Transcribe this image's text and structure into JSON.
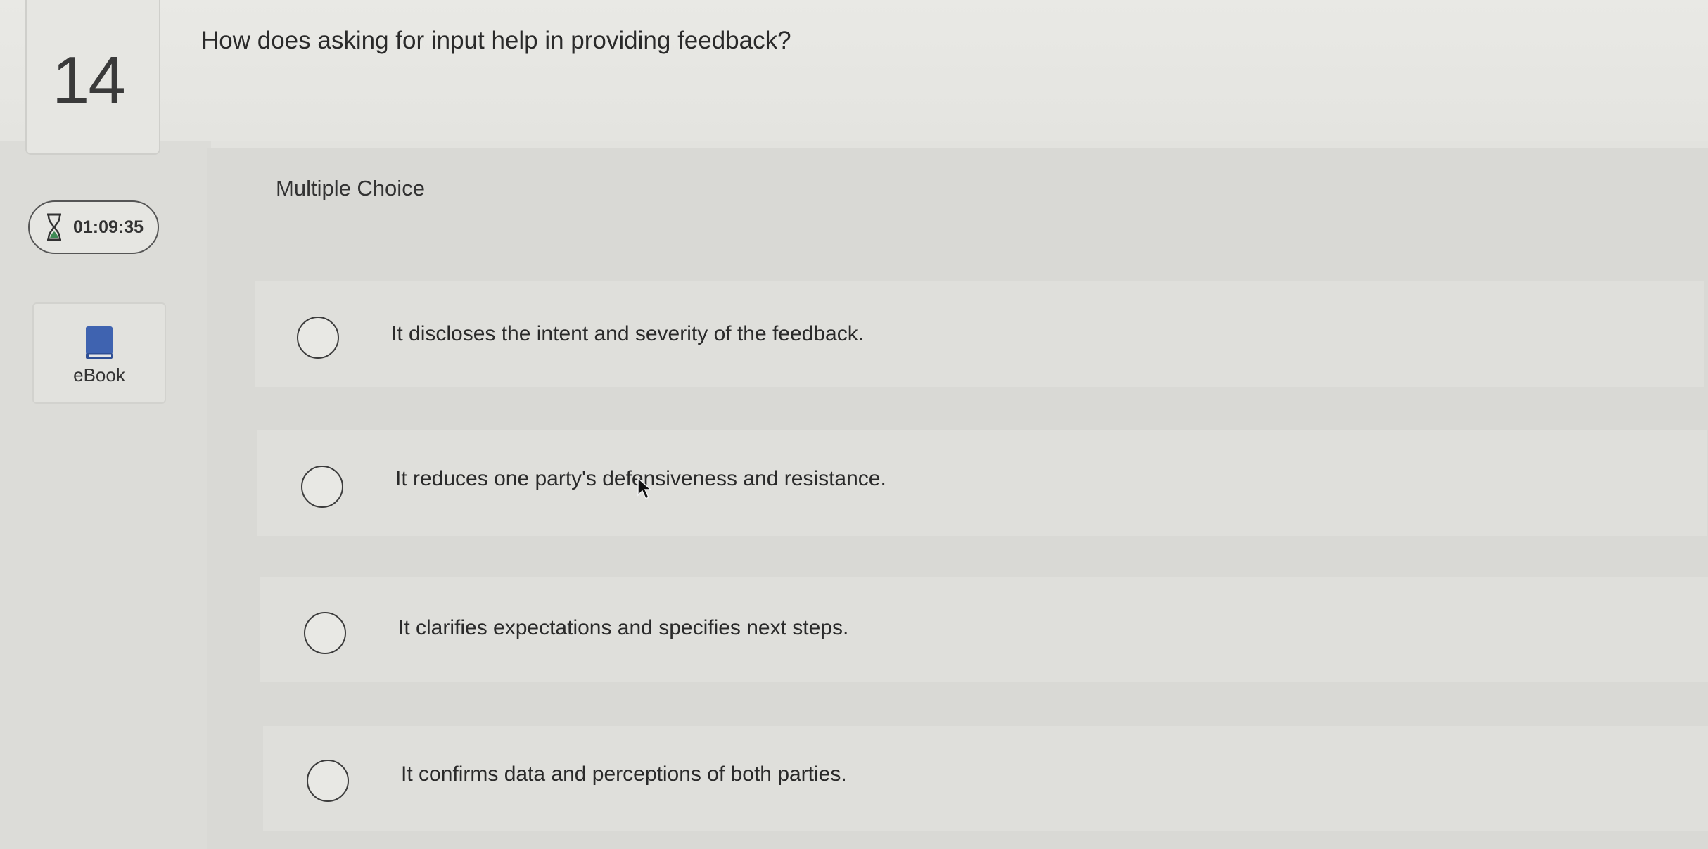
{
  "question": {
    "number": "14",
    "text": "How does asking for input help in providing feedback?",
    "type_label": "Multiple Choice"
  },
  "timer": {
    "icon": "hourglass-icon",
    "value": "01:09:35"
  },
  "ebook": {
    "icon": "book-icon",
    "label": "eBook"
  },
  "options": [
    {
      "label": "It discloses the intent and severity of the feedback."
    },
    {
      "label": "It reduces one party's defensiveness and resistance."
    },
    {
      "label": "It clarifies expectations and specifies next steps."
    },
    {
      "label": "It confirms data and perceptions of both parties."
    }
  ],
  "colors": {
    "background": "#e2e2de",
    "book": "#3f63b0",
    "hourglass": "#3f8a55"
  }
}
